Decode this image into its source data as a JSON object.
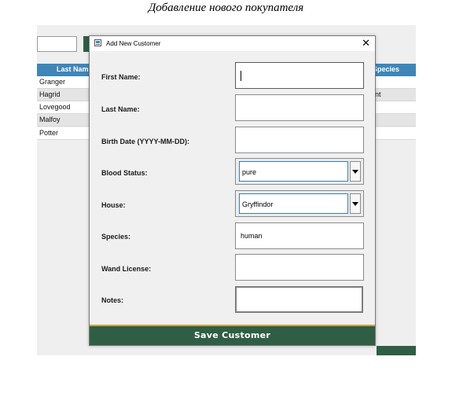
{
  "caption": "Добавление нового покупателя",
  "background_table": {
    "headers": {
      "last_name": "Last Nam",
      "species": "Species"
    },
    "rows": [
      {
        "last_name": "Granger",
        "species": ""
      },
      {
        "last_name": "Hagrid",
        "species": "nt"
      },
      {
        "last_name": "Lovegood",
        "species": ""
      },
      {
        "last_name": "Malfoy",
        "species": ""
      },
      {
        "last_name": "Potter",
        "species": ""
      }
    ]
  },
  "dialog": {
    "title": "Add New Customer",
    "close_glyph": "✕",
    "labels": {
      "first_name": "First Name:",
      "last_name": "Last Name:",
      "birth_date": "Birth Date (YYYY-MM-DD):",
      "blood_status": "Blood Status:",
      "house": "House:",
      "species": "Species:",
      "wand_license": "Wand License:",
      "notes": "Notes:"
    },
    "values": {
      "first_name": "",
      "last_name": "",
      "birth_date": "",
      "blood_status": "pure",
      "house": "Gryffindor",
      "species": "human",
      "wand_license": "",
      "notes": ""
    },
    "save_label": "Save Customer"
  },
  "colors": {
    "button_green": "#2f5e44",
    "header_blue": "#3f86b8",
    "button_border_gold": "#c9a43a"
  }
}
